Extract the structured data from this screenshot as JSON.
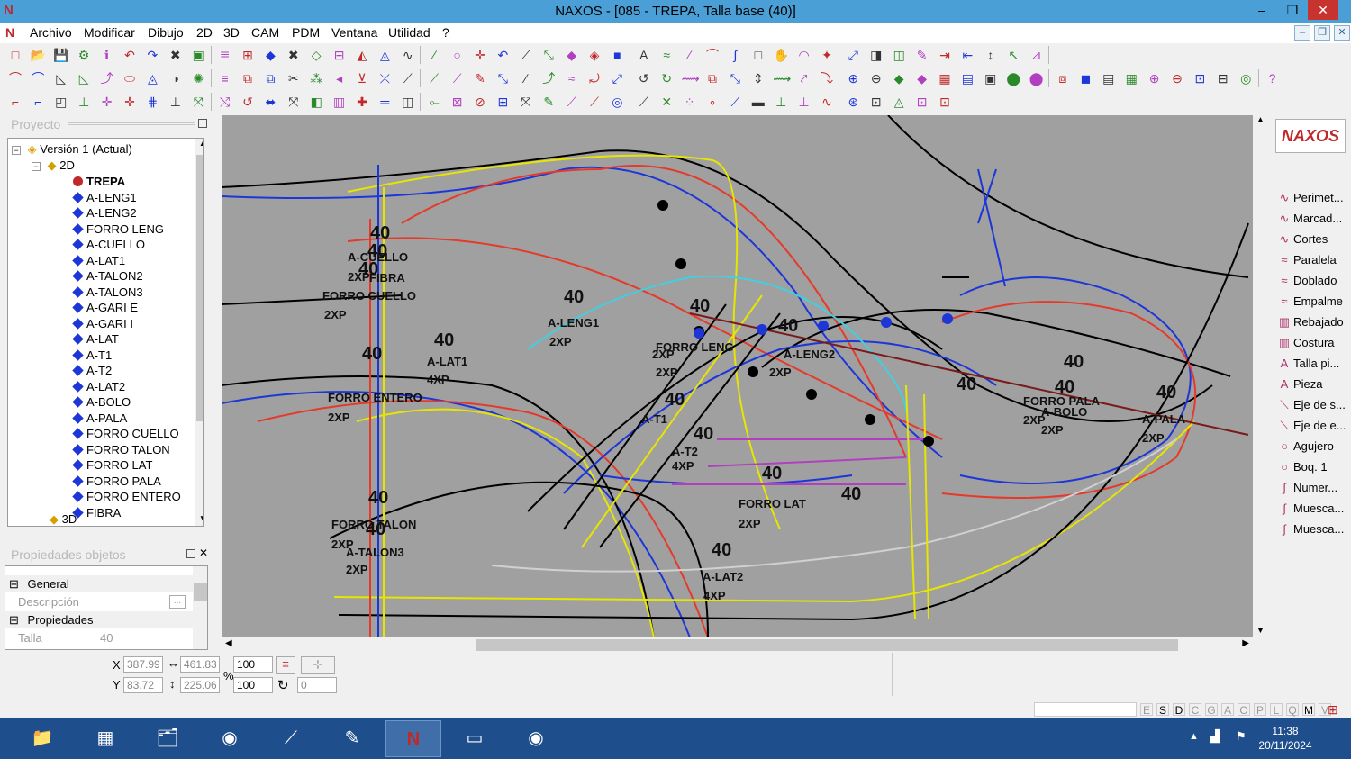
{
  "window": {
    "title": "NAXOS - [085 - TREPA, Talla base (40)]",
    "minimize": "–",
    "maximize": "❐",
    "close": "✕"
  },
  "menu": [
    "Archivo",
    "Modificar",
    "Dibujo",
    "2D",
    "3D",
    "CAM",
    "PDM",
    "Ventana",
    "Utilidad",
    "?"
  ],
  "project_panel": {
    "header": "Proyecto",
    "root": "Versión 1 (Actual)",
    "folder": "2D",
    "items": [
      "TREPA",
      "A-LENG1",
      "A-LENG2",
      "FORRO LENG",
      "A-CUELLO",
      "A-LAT1",
      "A-TALON2",
      "A-TALON3",
      "A-GARI E",
      "A-GARI I",
      "A-LAT",
      "A-T1",
      "A-T2",
      "A-LAT2",
      "A-BOLO",
      "A-PALA",
      "FORRO CUELLO",
      "FORRO TALON",
      "FORRO LAT",
      "FORRO PALA",
      "FORRO ENTERO",
      "FIBRA"
    ],
    "next_folder": "3D"
  },
  "properties_panel": {
    "header": "Propiedades objetos",
    "general": "General",
    "descripcion_label": "Descripción",
    "descripcion_btn": "...",
    "propiedades": "Propiedades",
    "talla_label": "Talla",
    "talla_value": "40"
  },
  "canvas_labels": [
    {
      "t": "40"
    },
    {
      "t": "40"
    },
    {
      "t": "A-CUELLO"
    },
    {
      "t": "40"
    },
    {
      "t": "2XP"
    },
    {
      "t": "FIBRA"
    },
    {
      "t": "FORRO CUELLO"
    },
    {
      "t": "2XP"
    },
    {
      "t": "40"
    },
    {
      "t": "A-LENG1"
    },
    {
      "t": "2XP"
    },
    {
      "t": "40"
    },
    {
      "t": "FORRO LENG"
    },
    {
      "t": "2XP"
    },
    {
      "t": "2XP"
    },
    {
      "t": "A-LENG2"
    },
    {
      "t": "2XP"
    },
    {
      "t": "40"
    },
    {
      "t": "40"
    },
    {
      "t": "A-LAT1"
    },
    {
      "t": "4XP"
    },
    {
      "t": "40"
    },
    {
      "t": "FORRO ENTERO"
    },
    {
      "t": "2XP"
    },
    {
      "t": "40"
    },
    {
      "t": "A-T1"
    },
    {
      "t": "A-T2"
    },
    {
      "t": "4XP"
    },
    {
      "t": "40"
    },
    {
      "t": "40"
    },
    {
      "t": "FORRO LAT"
    },
    {
      "t": "2XP"
    },
    {
      "t": "40"
    },
    {
      "t": "40"
    },
    {
      "t": "A-LAT2"
    },
    {
      "t": "4XP"
    },
    {
      "t": "40"
    },
    {
      "t": "FORRO TALON"
    },
    {
      "t": "40"
    },
    {
      "t": "2XP"
    },
    {
      "t": "A-TALON3"
    },
    {
      "t": "2XP"
    },
    {
      "t": "40"
    },
    {
      "t": "40"
    },
    {
      "t": "FORRO PALA"
    },
    {
      "t": "A-BOLO"
    },
    {
      "t": "2XP"
    },
    {
      "t": "2XP"
    },
    {
      "t": "40"
    },
    {
      "t": "40"
    },
    {
      "t": "A-PALA"
    },
    {
      "t": "2XP"
    }
  ],
  "right_tools": [
    "Perimet...",
    "Marcad...",
    "Cortes",
    "Paralela",
    "Doblado",
    "Empalme",
    "Rebajado",
    "Costura",
    "Talla pi...",
    "Pieza",
    "Eje de s...",
    "Eje de e...",
    "Agujero",
    "Boq. 1",
    "Numer...",
    "Muesca...",
    "Muesca..."
  ],
  "brand": "NAXOS",
  "status": {
    "x_label": "X",
    "x_value": "387.99",
    "y_label": "Y",
    "y_value": "83.72",
    "w_value": "461.83",
    "h_value": "225.06",
    "percent": "%",
    "scale_x": "100",
    "scale_y": "100",
    "rotation": "0"
  },
  "layers": [
    "E",
    "S",
    "D",
    "C",
    "G",
    "A",
    "O",
    "P",
    "L",
    "Q",
    "M",
    "V"
  ],
  "taskbar": {
    "time": "11:38",
    "date": "20/11/2024"
  }
}
